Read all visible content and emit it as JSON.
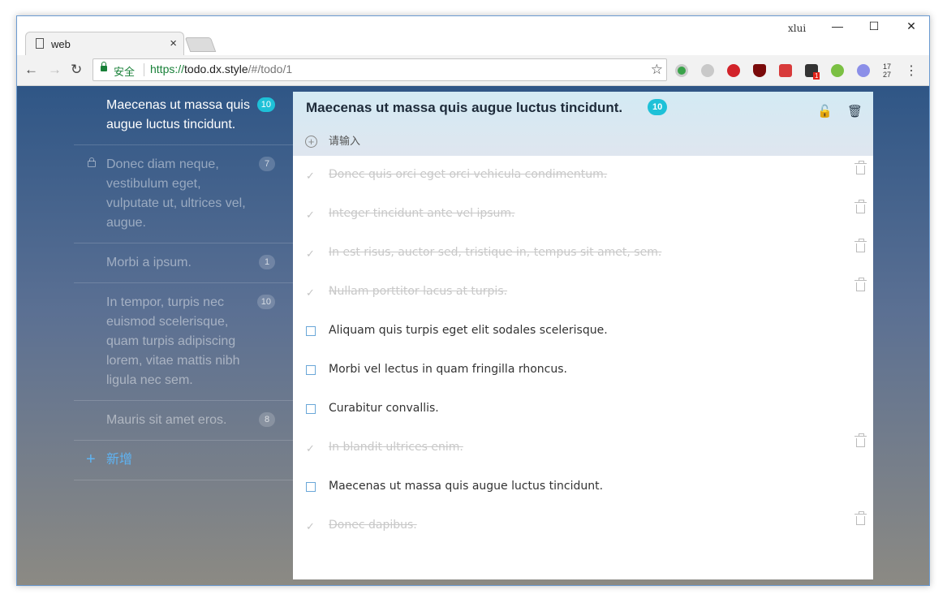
{
  "browser": {
    "tab_title": "web",
    "tab_close": "×",
    "user": "xlui",
    "minimize": "—",
    "maximize": "☐",
    "close": "✕",
    "back": "←",
    "forward": "→",
    "reload": "↻",
    "secure_label": "安全",
    "url_proto": "https://",
    "url_host": "todo.dx.style",
    "url_path": "/#/todo/1",
    "star": "☆",
    "menu": "⋮",
    "extension_badge": "1",
    "time_hour": "17",
    "time_minute": "27"
  },
  "sidebar": {
    "items": [
      {
        "label": "Maecenas ut massa quis augue luctus tincidunt.",
        "count": "10"
      },
      {
        "label": "Donec diam neque, vestibulum eget, vulputate ut, ultrices vel, augue.",
        "count": "7"
      },
      {
        "label": "Morbi a ipsum.",
        "count": "1"
      },
      {
        "label": "In tempor, turpis nec euismod scelerisque, quam turpis adipiscing lorem, vitae mattis nibh ligula nec sem.",
        "count": "10"
      },
      {
        "label": "Mauris sit amet eros.",
        "count": "8"
      }
    ],
    "add_label": "新增",
    "add_icon": "+"
  },
  "main": {
    "title": "Maecenas ut massa quis augue luctus tincidunt.",
    "count": "10",
    "unlock_icon": "🔓",
    "trash_icon": "🗑",
    "input_placeholder": "请输入",
    "check": "✓",
    "todos": [
      {
        "text": "Donec quis orci eget orci vehicula condimentum.",
        "done": true
      },
      {
        "text": "Integer tincidunt ante vel ipsum.",
        "done": true
      },
      {
        "text": "In est risus, auctor sed, tristique in, tempus sit amet, sem.",
        "done": true
      },
      {
        "text": "Nullam porttitor lacus at turpis.",
        "done": true
      },
      {
        "text": "Aliquam quis turpis eget elit sodales scelerisque.",
        "done": false
      },
      {
        "text": "Morbi vel lectus in quam fringilla rhoncus.",
        "done": false
      },
      {
        "text": "Curabitur convallis.",
        "done": false
      },
      {
        "text": "In blandit ultrices enim.",
        "done": true
      },
      {
        "text": "Maecenas ut massa quis augue luctus tincidunt.",
        "done": false
      },
      {
        "text": "Donec dapibus.",
        "done": true
      }
    ]
  },
  "colors": {
    "accent": "#1ec1d8",
    "link": "#5fb3f2",
    "secure": "#188038"
  }
}
